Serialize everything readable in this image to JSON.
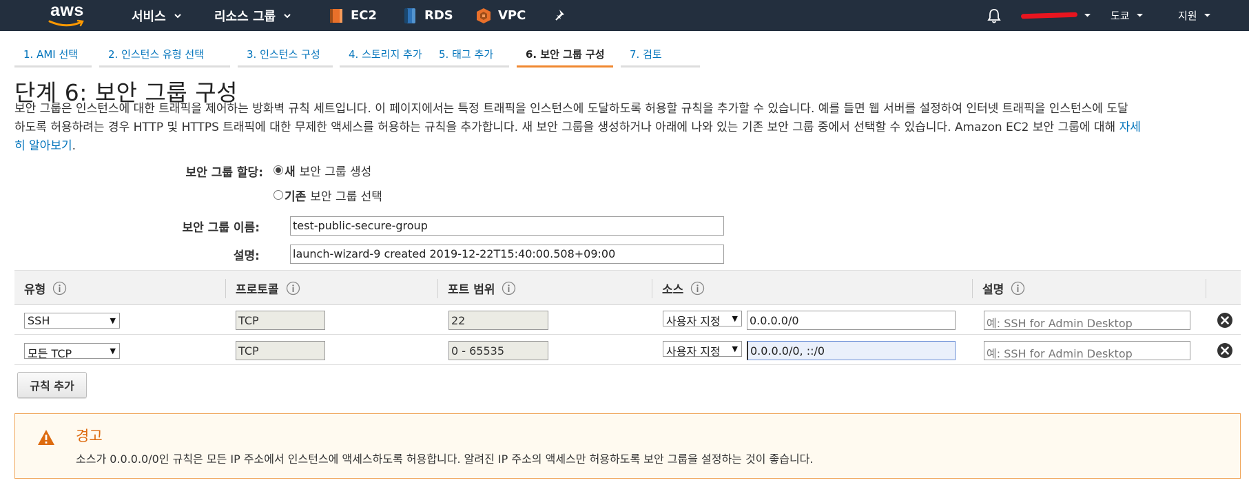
{
  "topnav": {
    "logo_text": "aws",
    "services_label": "서비스",
    "resource_groups_label": "리소스 그룹",
    "shortcuts": [
      {
        "label": "EC2",
        "icon": "ec2-icon",
        "color": "#e8702a"
      },
      {
        "label": "RDS",
        "icon": "rds-icon",
        "color": "#2e73b8"
      },
      {
        "label": "VPC",
        "icon": "vpc-icon",
        "color": "#e8702a"
      }
    ],
    "region_label": "도쿄",
    "support_label": "지원"
  },
  "steps": [
    {
      "label": "1. AMI 선택",
      "active": false
    },
    {
      "label": "2. 인스턴스 유형 선택",
      "active": false
    },
    {
      "label": "3. 인스턴스 구성",
      "active": false
    },
    {
      "label": "4. 스토리지 추가",
      "active": false
    },
    {
      "label": "5. 태그 추가",
      "active": false
    },
    {
      "label": "6. 보안 그룹 구성",
      "active": true
    },
    {
      "label": "7. 검토",
      "active": false
    }
  ],
  "page": {
    "title": "단계 6: 보안 그룹 구성",
    "description_line1": "보안 그룹은 인스턴스에 대한 트래픽을 제어하는 방화벽 규칙 세트입니다. 이 페이지에서는 특정 트래픽을 인스턴스에 도달하도록 허용할 규칙을 추가할 수 있습니다. 예를 들면 웹 서버를 설정하여 인터넷 트래픽을 인스턴스에 도달",
    "description_line2": "하도록 허용하려는 경우 HTTP 및 HTTPS 트래픽에 대한 무제한 액세스를 허용하는 규칙을 추가합니다. 새 보안 그룹을 생성하거나 아래에 나와 있는 기존 보안 그룹 중에서 선택할 수 있습니다. Amazon EC2 보안 그룹에 대해",
    "learn_more_a": "자세",
    "learn_more_b": "히 알아보기",
    "learn_more_suffix": "."
  },
  "form": {
    "assign_label": "보안 그룹 할당:",
    "option_new_bold": "새",
    "option_new_rest": "보안 그룹 생성",
    "option_existing_bold": "기존",
    "option_existing_rest": "보안 그룹 선택",
    "selected_option": "new",
    "name_label": "보안 그룹 이름:",
    "name_value": "test-public-secure-group",
    "desc_label": "설명:",
    "desc_value": "launch-wizard-9 created 2019-12-22T15:40:00.508+09:00"
  },
  "table": {
    "headers": [
      "유형",
      "프로토콜",
      "포트 범위",
      "소스",
      "설명"
    ],
    "rows": [
      {
        "type": "SSH",
        "protocol": "TCP",
        "port": "22",
        "source_type": "사용자 지정",
        "source": "0.0.0.0/0",
        "description_placeholder": "예: SSH for Admin Desktop"
      },
      {
        "type": "모든 TCP",
        "protocol": "TCP",
        "port": "0 - 65535",
        "source_type": "사용자 지정",
        "source": "0.0.0.0/0, ::/0",
        "description_placeholder": "예: SSH for Admin Desktop"
      }
    ]
  },
  "add_rule_label": "규칙 추가",
  "warning": {
    "title": "경고",
    "text": "소스가 0.0.0.0/0인 규칙은 모든 IP 주소에서 인스턴스에 액세스하도록 허용합니다. 알려진 IP 주소의 액세스만 허용하도록 보안 그룹을 설정하는 것이 좋습니다.",
    "color": "#dd6b10"
  }
}
